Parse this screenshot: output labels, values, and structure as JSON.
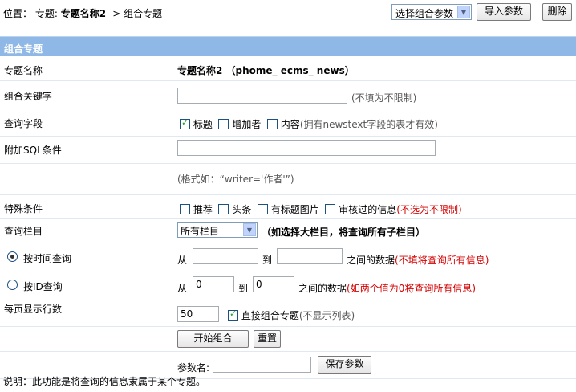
{
  "breadcrumb": {
    "prefix": "位置：",
    "topic_prefix": "专题: ",
    "topic_name": "专题名称2",
    "arrow": " -> ",
    "current": "组合专题"
  },
  "toolbar": {
    "select_label": "选择组合参数",
    "import_label": "导入参数",
    "delete_label": "删除"
  },
  "section_title": "组合专题",
  "rows": {
    "topic_name": {
      "label": "专题名称",
      "value": "专题名称2 （phome_ ecms_ news）"
    },
    "keyword": {
      "label": "组合关键字",
      "value": "",
      "hint": "(不填为不限制)"
    },
    "query_fields": {
      "label": "查询字段",
      "opt_title": "标题",
      "opt_title_checked": true,
      "opt_adder": "增加者",
      "opt_adder_checked": false,
      "opt_content": "内容",
      "opt_content_checked": false,
      "content_note": "(拥有newstext字段的表才有效)"
    },
    "sql": {
      "label": "附加SQL条件",
      "value": "",
      "hint": "(格式如：“writer='作者'”)"
    },
    "special": {
      "label": "特殊条件",
      "opt1": "推荐",
      "opt2": "头条",
      "opt3": "有标题图片",
      "opt4": "审核过的信息",
      "note": "(不选为不限制)"
    },
    "column": {
      "label": "查询栏目",
      "selected": "所有栏目",
      "note": "（如选择大栏目，将查询所有子栏目）"
    },
    "by_time": {
      "label": "按时间查询",
      "checked": true,
      "from": "从",
      "to": "到",
      "from_value": "",
      "to_value": "",
      "between": "之间的数据",
      "note": "(不填将查询所有信息)"
    },
    "by_id": {
      "label": "按ID查询",
      "checked": false,
      "from": "从",
      "to": "到",
      "from_value": "0",
      "to_value": "0",
      "between": "之间的数据",
      "note": "(如两个值为0将查询所有信息)"
    },
    "per_page": {
      "label": "每页显示行数",
      "value": "50",
      "direct_label": "直接组合专题",
      "direct_checked": true,
      "direct_note": "(不显示列表)"
    },
    "actions": {
      "start": "开始组合",
      "reset": "重置"
    },
    "param": {
      "label": "参数名:",
      "value": "",
      "save": "保存参数"
    }
  },
  "footer_note": "说明：此功能是将查询的信息隶属于某个专题。"
}
